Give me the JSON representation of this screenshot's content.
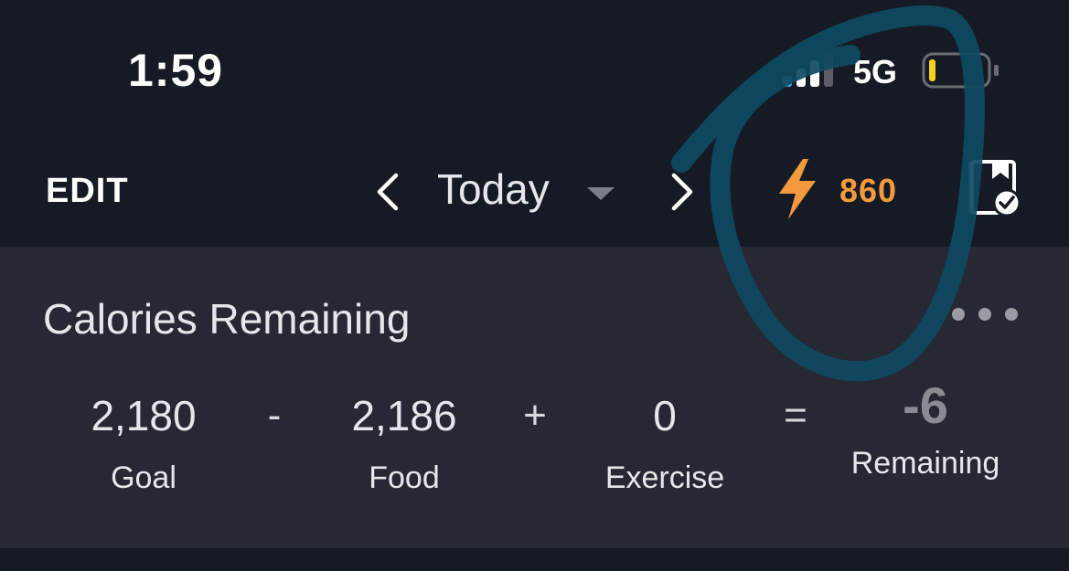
{
  "status_bar": {
    "time": "1:59",
    "network": "5G",
    "signal_icon": "cellular-signal-icon",
    "battery_icon": "battery-low-icon",
    "battery_color": "#f5d21e"
  },
  "nav": {
    "edit_label": "EDIT",
    "date_label": "Today",
    "prev_icon": "chevron-left-icon",
    "next_icon": "chevron-right-icon",
    "caret_icon": "caret-down-icon",
    "streak_icon": "lightning-bolt-icon",
    "streak_count": "860",
    "streak_color": "#f29a3c",
    "log_icon": "completed-log-icon",
    "log_accent_color": "#2aa7e0"
  },
  "calories_card": {
    "title": "Calories Remaining",
    "more_icon": "more-options-icon",
    "goal_value": "2,180",
    "goal_label": "Goal",
    "op_minus": "-",
    "food_value": "2,186",
    "food_label": "Food",
    "op_plus": "+",
    "exercise_value": "0",
    "exercise_label": "Exercise",
    "op_equals": "=",
    "remaining_value": "-6",
    "remaining_label": "Remaining"
  },
  "colors": {
    "background": "#161a25",
    "card": "#262933",
    "annotation_stroke": "#0e4a63"
  }
}
